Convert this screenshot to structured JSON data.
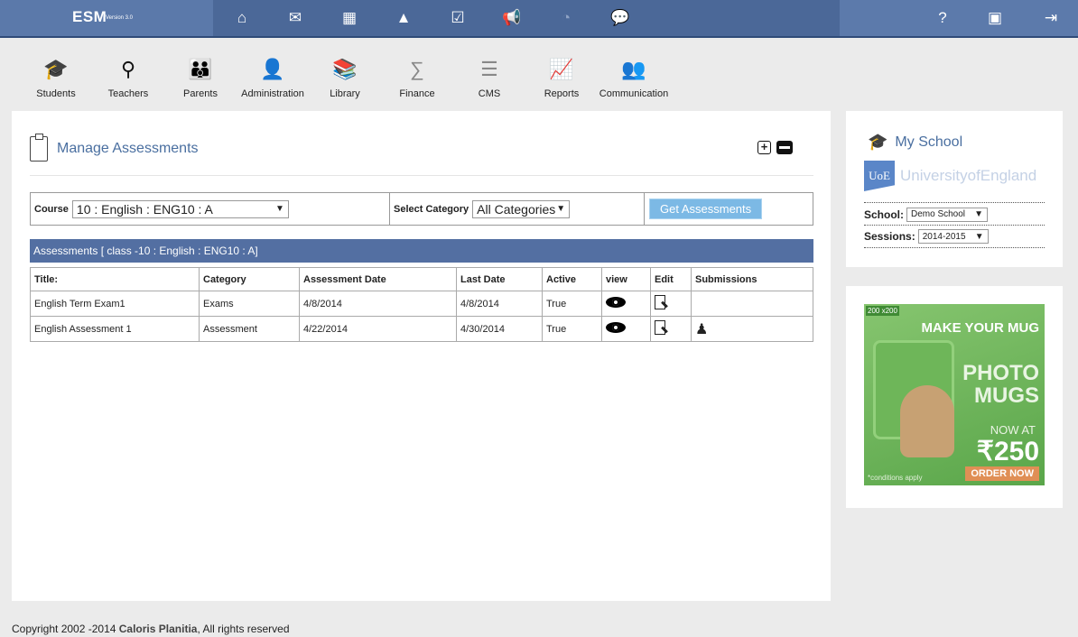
{
  "topbar": {
    "brand": "ESM",
    "version": "Version 3.0"
  },
  "modules": [
    {
      "label": "Students",
      "icon": "student-icon"
    },
    {
      "label": "Teachers",
      "icon": "teacher-icon"
    },
    {
      "label": "Parents",
      "icon": "parents-icon"
    },
    {
      "label": "Administration",
      "icon": "admin-icon"
    },
    {
      "label": "Library",
      "icon": "library-icon"
    },
    {
      "label": "Finance",
      "icon": "finance-icon"
    },
    {
      "label": "CMS",
      "icon": "cms-icon"
    },
    {
      "label": "Reports",
      "icon": "reports-icon"
    },
    {
      "label": "Communication",
      "icon": "communication-icon"
    }
  ],
  "page": {
    "title": "Manage Assessments"
  },
  "filters": {
    "course_label": "Course",
    "course_value": "10 : English : ENG10 : A",
    "category_label": "Select Category",
    "category_value": "All Categories",
    "get_button": "Get Assessments"
  },
  "table": {
    "heading": "Assessments [ class -10 : English : ENG10 : A]",
    "columns": [
      "Title:",
      "Category",
      "Assessment Date",
      "Last Date",
      "Active",
      "view",
      "Edit",
      "Submissions"
    ],
    "rows": [
      {
        "title": "English Term Exam1",
        "category": "Exams",
        "assessment_date": "4/8/2014",
        "last_date": "4/8/2014",
        "active": "True",
        "has_submissions": false
      },
      {
        "title": "English Assessment 1",
        "category": "Assessment",
        "assessment_date": "4/22/2014",
        "last_date": "4/30/2014",
        "active": "True",
        "has_submissions": true
      }
    ]
  },
  "school": {
    "title": "My School",
    "logo_abbr": "UoE",
    "logo_name": "UniversityofEngland",
    "school_label": "School:",
    "school_value": "Demo School",
    "sessions_label": "Sessions:",
    "sessions_value": "2014-2015"
  },
  "ad": {
    "tag": "200 x200",
    "headline": "MAKE YOUR MUG",
    "product": "PHOTO MUGS",
    "now_at": "NOW AT",
    "price": "₹250",
    "cta": "ORDER NOW",
    "note": "*conditions apply"
  },
  "footer": {
    "prefix": "Copyright 2002 -2014 ",
    "company": "Caloris Planitia",
    "suffix": ", All rights reserved"
  }
}
